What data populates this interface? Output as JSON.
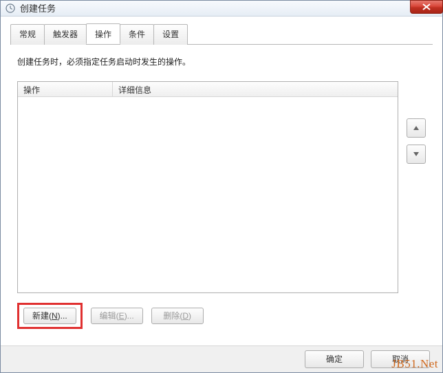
{
  "window": {
    "title": "创建任务"
  },
  "tabs": {
    "general": "常规",
    "triggers": "触发器",
    "actions": "操作",
    "conditions": "条件",
    "settings": "设置"
  },
  "content": {
    "instruction": "创建任务时，必须指定任务启动时发生的操作。",
    "column_action": "操作",
    "column_details": "详细信息"
  },
  "buttons": {
    "new_prefix": "新建(",
    "new_key": "N",
    "new_suffix": ")...",
    "edit_prefix": "编辑(",
    "edit_key": "E",
    "edit_suffix": ")...",
    "delete_prefix": "删除(",
    "delete_key": "D",
    "delete_suffix": ")",
    "ok": "确定",
    "cancel": "取消"
  },
  "watermark": "JB51.Net"
}
